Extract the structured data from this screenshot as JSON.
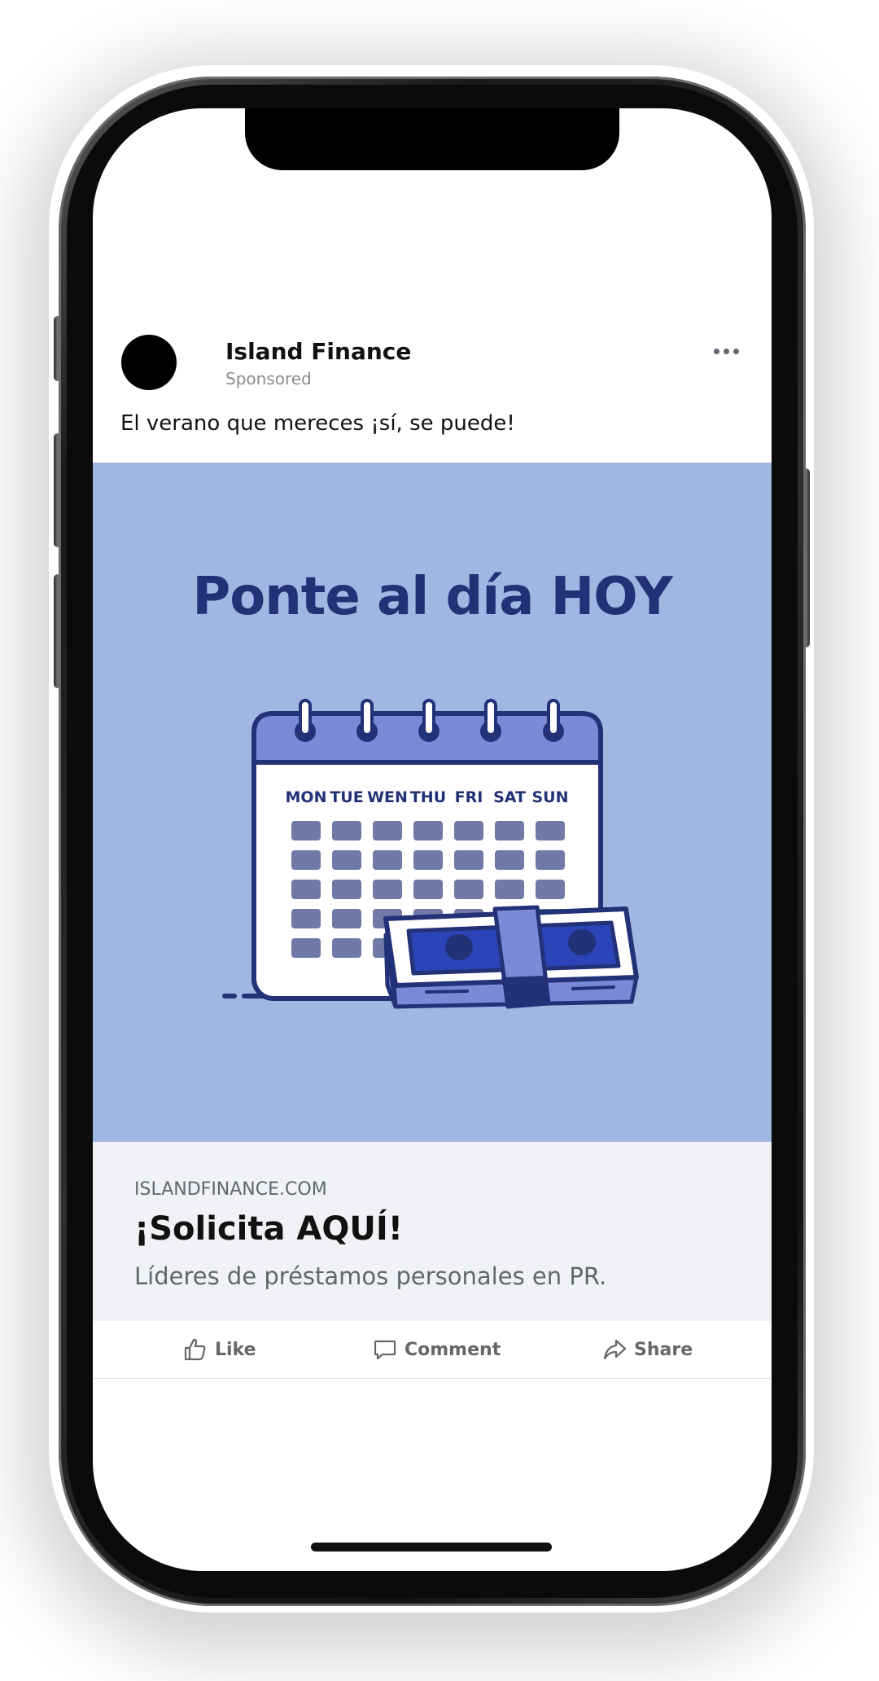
{
  "post": {
    "page_name": "Island Finance",
    "sponsored_label": "Sponsored",
    "caption": "El verano que mereces ¡sí, se puede!"
  },
  "creative": {
    "headline": "Ponte al día HOY",
    "calendar_days": [
      "MON",
      "TUE",
      "WEN",
      "THU",
      "FRI",
      "SAT",
      "SUN"
    ]
  },
  "link_preview": {
    "domain": "ISLANDFINANCE.COM",
    "title": "¡Solicita AQUÍ!",
    "description": "Líderes de préstamos personales en PR."
  },
  "actions": {
    "like": "Like",
    "comment": "Comment",
    "share": "Share"
  },
  "icons": {
    "more": "more-options-icon",
    "like": "thumbs-up-icon",
    "comment": "comment-icon",
    "share": "share-icon"
  },
  "colors": {
    "creative_background": "#a0b7e3",
    "headline": "#233177",
    "link_box": "#f0f2f5",
    "action_text": "#65676b"
  }
}
